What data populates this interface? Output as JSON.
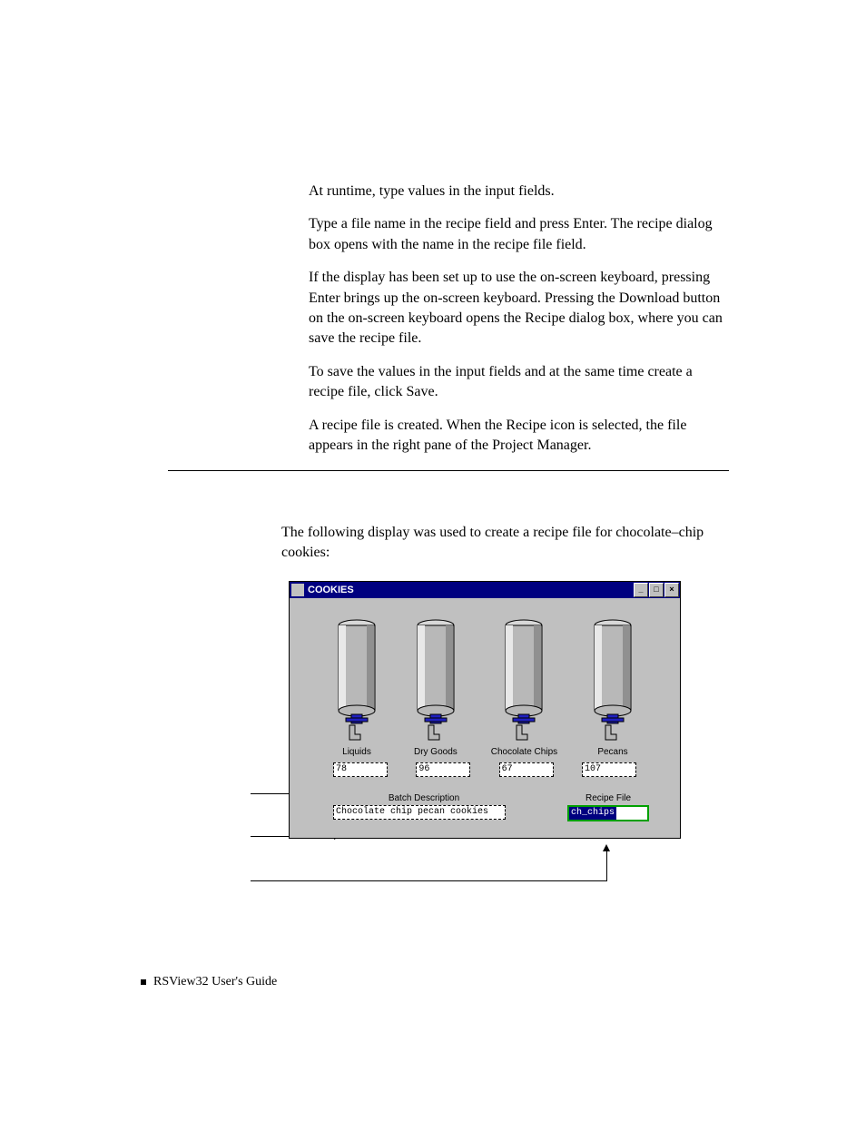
{
  "paragraphs": {
    "p1": "At runtime, type values in the input fields.",
    "p2": "Type a file name in the recipe field and press Enter. The recipe dialog box opens with the name in the recipe file field.",
    "p3": "If the display has been set up to use the on-screen keyboard, pressing Enter brings up the on-screen keyboard. Pressing the Download button on the on-screen keyboard opens the Recipe dialog box, where you can save the recipe file.",
    "p4": "To save the values in the input fields and at the same time create a recipe file, click Save.",
    "p5": "A recipe file is created. When the Recipe icon is selected, the file appears in the right pane of the Project Manager."
  },
  "intro": "The following display was used to create a recipe file for chocolate–chip cookies:",
  "window": {
    "title": "COOKIES",
    "minimize": "_",
    "maximize": "□",
    "close": "×"
  },
  "tanks": [
    {
      "label": "Liquids",
      "value": "78"
    },
    {
      "label": "Dry Goods",
      "value": "96"
    },
    {
      "label": "Chocolate Chips",
      "value": "67"
    },
    {
      "label": "Pecans",
      "value": "107"
    }
  ],
  "batch": {
    "label": "Batch Description",
    "value": "Chocolate chip pecan cookies"
  },
  "recipe": {
    "label": "Recipe File",
    "value": "ch_chips"
  },
  "footer": "RSView32  User's Guide"
}
